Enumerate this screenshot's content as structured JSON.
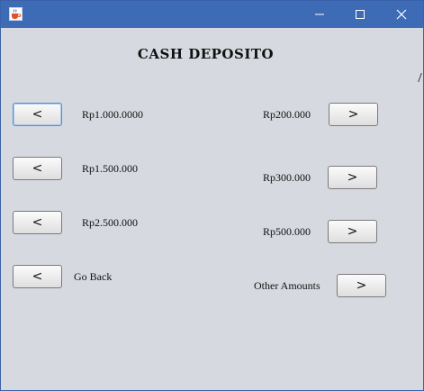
{
  "window": {
    "icon": "java-cup-icon",
    "controls": [
      "minimize-icon",
      "maximize-icon",
      "close-icon"
    ]
  },
  "heading": "CASH DEPOSITO",
  "left_column": [
    {
      "button_label": "<",
      "label": "Rp1.000.0000"
    },
    {
      "button_label": "<",
      "label": "Rp1.500.000"
    },
    {
      "button_label": "<",
      "label": "Rp2.500.000"
    },
    {
      "button_label": "<",
      "label": "Go Back"
    }
  ],
  "right_column": [
    {
      "label": "Rp200.000",
      "button_label": ">"
    },
    {
      "label": "Rp300.000",
      "button_label": ">"
    },
    {
      "label": "Rp500.000",
      "button_label": ">"
    },
    {
      "label": "Other Amounts",
      "button_label": ">"
    }
  ],
  "colors": {
    "titlebar": "#3e6bb6",
    "client_background": "#d6d9df",
    "button_focus": "#5b8fd0"
  }
}
